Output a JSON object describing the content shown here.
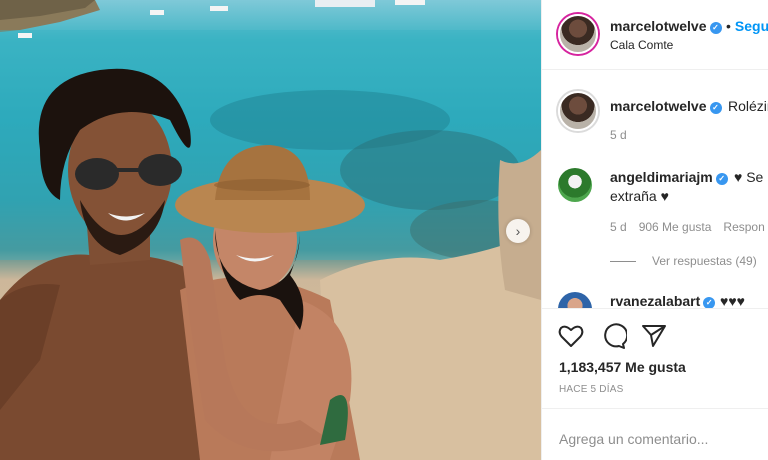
{
  "post": {
    "username": "marcelotwelve",
    "follow_label": "Segu",
    "separator": "•",
    "location": "Cala Comte"
  },
  "caption": {
    "username": "marcelotwelve",
    "text": "Rolézin",
    "age": "5 d"
  },
  "comments": [
    {
      "username": "angeldimariajm",
      "text_line1": "♥ Se",
      "text_line2": "extraña ♥",
      "age": "5 d",
      "likes": "906 Me gusta",
      "reply_label": "Respon",
      "view_replies": "Ver respuestas (49)"
    },
    {
      "username": "rvanezalabart",
      "text_line1": "♥♥♥"
    }
  ],
  "actions": {
    "likes": "1,183,457 Me gusta",
    "time": "HACE 5 DÍAS"
  },
  "composer": {
    "placeholder": "Agrega un comentario..."
  },
  "colors": {
    "accent": "#0095f6",
    "verified": "#3897f0",
    "secondary_text": "#8e8e8e"
  }
}
